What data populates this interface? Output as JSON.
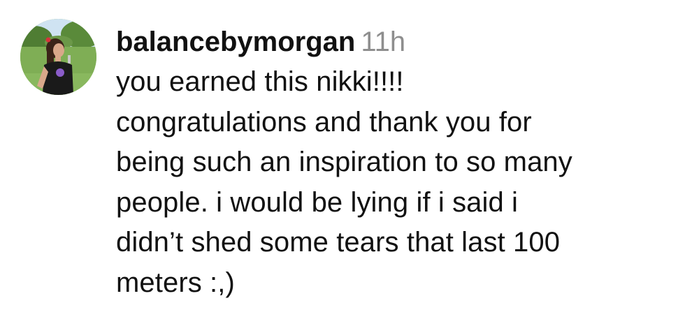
{
  "comment": {
    "username": "balancebymorgan",
    "timestamp": "11h",
    "text": "you earned this nikki!!!!\ncongratulations and thank you for\nbeing such an inspiration to so many\npeople. i would be lying if i said i\ndidn’t shed some tears that last 100\nmeters :,)"
  },
  "avatar": {
    "icon": "profile-photo",
    "colors": {
      "sky": "#cfe3f2",
      "trees": "#4f7d33",
      "grass": "#7fae55",
      "shirt": "#1a1a1a",
      "shirt_logo": "#8a5cc9",
      "skin": "#d9a88a",
      "hair": "#3b2418",
      "hair_bow": "#d6333a"
    }
  }
}
